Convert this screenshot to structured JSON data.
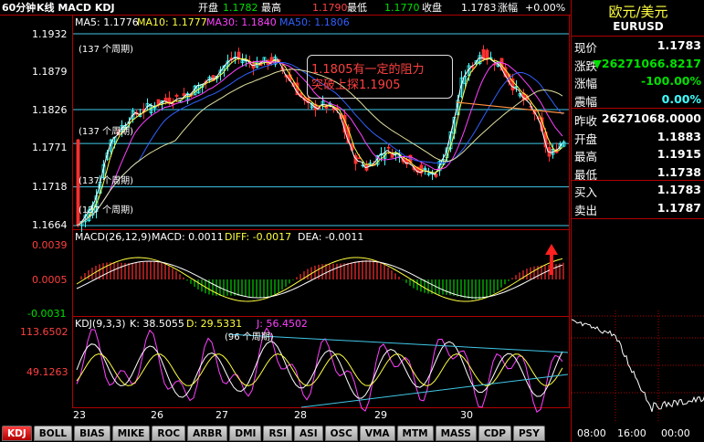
{
  "header": {
    "period": "60分钟",
    "indicators": "K线  MACD  KDJ",
    "open_label": "开盘",
    "open_value": "1.1782",
    "high_label": "最高",
    "high_value": "1.1790",
    "low_label": "最低",
    "low_value": "1.1770",
    "close_label": "收盘",
    "close_value": "1.1783",
    "change_label": "涨幅",
    "change_value": "+0.00%"
  },
  "ma": {
    "ma5": "MA5: 1.1776",
    "ma10": "MA10: 1.1777",
    "ma30": "MA30: 1.1840",
    "ma50": "MA50: 1.1806"
  },
  "price_axis": [
    "1.1932",
    "1.1879",
    "1.1826",
    "1.1771",
    "1.1718",
    "1.1664"
  ],
  "period_labels": [
    "(137 个周期)",
    "(137 个周期)",
    "(137 个周期)",
    "(137 个周期)"
  ],
  "annotation": {
    "line1": "1.1805有一定的阻力",
    "line2": "突破上探1.1905"
  },
  "macd": {
    "title": "MACD(26,12,9)",
    "macd": "MACD: 0.0011",
    "diff": "DIFF: -0.0017",
    "dea": "DEA: -0.0011",
    "axis": [
      "0.0039",
      "0.0005",
      "-0.0031"
    ]
  },
  "kdj": {
    "title": "KDJ(9,3,3)",
    "k": "K: 38.5055",
    "d": "D: 29.5331",
    "j": "J: 56.4502",
    "axis": [
      "113.6502",
      "49.1263"
    ],
    "period_label": "(96 个周期)"
  },
  "dates": [
    "23",
    "26",
    "27",
    "28",
    "29",
    "30"
  ],
  "tabs": [
    "KDJ",
    "BOLL",
    "BIAS",
    "MIKE",
    "ROC",
    "ARBR",
    "DMI",
    "RSI",
    "ASI",
    "OSC",
    "VMA",
    "MTM",
    "MASS",
    "CDP",
    "PSY"
  ],
  "panel": {
    "title": "欧元/美元",
    "symbol": "EURUSD",
    "rows1": [
      {
        "k": "现价",
        "v": "1.1783",
        "c": "#ffffff"
      },
      {
        "k": "涨跌",
        "v": "▼26271066.8217",
        "c": "#00e000"
      },
      {
        "k": "涨幅",
        "v": "-100.00%",
        "c": "#00e000"
      },
      {
        "k": "震幅",
        "v": "0.00%",
        "c": "#40ffff"
      }
    ],
    "rows2": [
      {
        "k": "昨收",
        "v": "26271068.0000",
        "c": "#ffffff"
      },
      {
        "k": "开盘",
        "v": "1.1883",
        "c": "#ffffff"
      },
      {
        "k": "最高",
        "v": "1.1915",
        "c": "#ffffff"
      },
      {
        "k": "最低",
        "v": "1.1738",
        "c": "#ffffff"
      }
    ],
    "rows3": [
      {
        "k": "买入",
        "v": "1.1783",
        "c": "#ffffff"
      },
      {
        "k": "卖出",
        "v": "1.1787",
        "c": "#ffffff"
      }
    ],
    "time_labels": [
      "08:00",
      "16:00",
      "00:00"
    ]
  },
  "colors": {
    "up": "#40ffff",
    "down": "#ff3030",
    "ma5": "#ffffff",
    "ma10": "#ffff40",
    "ma30": "#ff40ff",
    "ma50": "#3060ff",
    "frame": "#b00000"
  }
}
